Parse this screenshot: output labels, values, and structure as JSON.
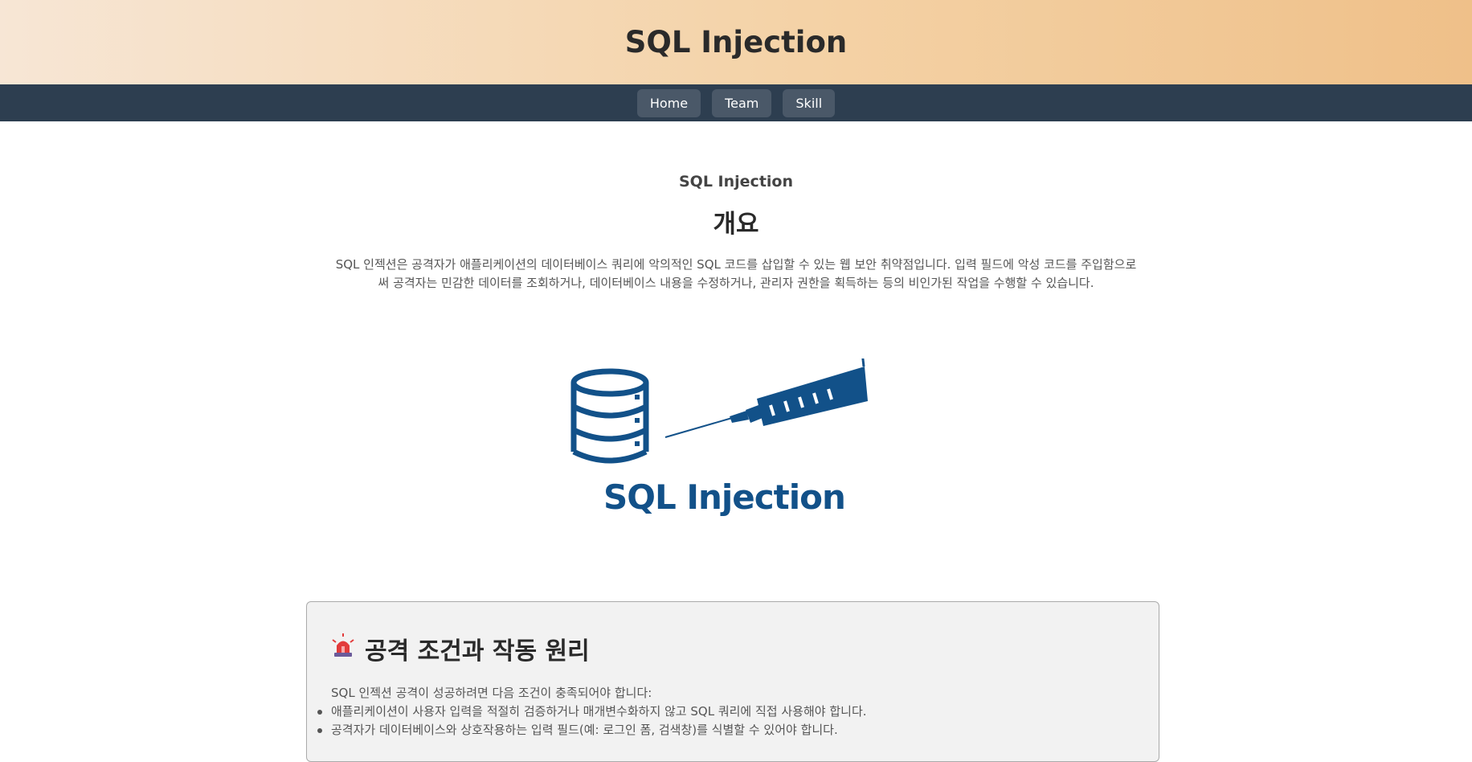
{
  "header": {
    "title": "SQL Injection"
  },
  "nav": {
    "items": [
      {
        "label": "Home"
      },
      {
        "label": "Team"
      },
      {
        "label": "Skill"
      }
    ]
  },
  "overview": {
    "subtitle": "SQL Injection",
    "title": "개요",
    "description": "SQL 인젝션은 공격자가 애플리케이션의 데이터베이스 쿼리에 악의적인 SQL 코드를 삽입할 수 있는 웹 보안 취약점입니다. 입력 필드에 악성 코드를 주입함으로써 공격자는 민감한 데이터를 조회하거나, 데이터베이스 내용을 수정하거나, 관리자 권한을 획득하는 등의 비인가된 작업을 수행할 수 있습니다."
  },
  "illustration": {
    "caption": "SQL Injection",
    "icons": [
      "database-icon",
      "syringe-icon"
    ],
    "color": "#125189"
  },
  "conditions": {
    "icon": "siren-icon",
    "title": "공격 조건과 작동 원리",
    "intro": "SQL 인젝션 공격이 성공하려면 다음 조건이 충족되어야 합니다:",
    "items": [
      "애플리케이션이 사용자 입력을 적절히 검증하거나 매개변수화하지 않고 SQL 쿼리에 직접 사용해야 합니다.",
      "공격자가 데이터베이스와 상호작용하는 입력 필드(예: 로그인 폼, 검색창)를 식별할 수 있어야 합니다."
    ]
  },
  "colors": {
    "header_gradient_start": "#f7e6d5",
    "header_gradient_end": "#efc089",
    "nav_bg": "#2d3e50",
    "nav_button_bg": "#4a5868",
    "brand_blue": "#125189",
    "card_bg": "#f2f2f2"
  }
}
